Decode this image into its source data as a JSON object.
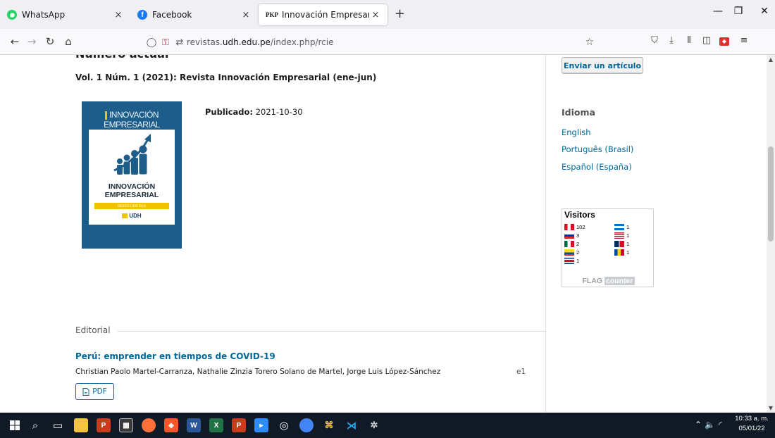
{
  "browser": {
    "tabs": [
      {
        "label": "WhatsApp",
        "favicon": "whatsapp-icon",
        "active": false
      },
      {
        "label": "Facebook",
        "favicon": "facebook-icon",
        "active": false
      },
      {
        "label": "Innovación Empresarial",
        "favicon": "pkp-icon",
        "favicon_text": "PKP",
        "active": true
      }
    ],
    "close_glyph": "×",
    "new_tab_glyph": "+",
    "url_prefix": "revistas.",
    "url_host": "udh.edu.pe",
    "url_path": "/index.php/rcie",
    "window_controls": {
      "minimize": "—",
      "maximize": "❐",
      "close": "✕"
    }
  },
  "page": {
    "clipped_heading": "Número actual",
    "issue_title": "Vol. 1 Núm. 1 (2021): Revista Innovación Empresarial (ene-jun)",
    "cover": {
      "top_text": "INNOVACIÓN EMPRESARIAL",
      "name_line1": "INNOVACIÓN",
      "name_line2": "EMPRESARIAL",
      "band_text": "REVISTA CIENTÍFICA",
      "logo_text": "UDH"
    },
    "published_label": "Publicado:",
    "published_date": "2021-10-30",
    "section_label": "Editorial",
    "article": {
      "title": "Perú: emprender en tiempos de COVID-19",
      "authors": "Christian Paolo Martel-Carranza, Nathalie Zinzia Torero Solano de Martel, Jorge Luis López-Sánchez",
      "pages": "e1",
      "pdf_label": "PDF"
    }
  },
  "sidebar": {
    "submit_label": "Enviar un artículo",
    "language_title": "Idioma",
    "languages": [
      "English",
      "Português (Brasil)",
      "Español (España)"
    ],
    "visitors": {
      "title": "Visitors",
      "entries": [
        {
          "country": "Peru",
          "count": "102"
        },
        {
          "country": "Russia",
          "count": "3"
        },
        {
          "country": "Mexico",
          "count": "2"
        },
        {
          "country": "Ecuador",
          "count": "2"
        },
        {
          "country": "Costa Rica",
          "count": "1"
        },
        {
          "country": "Honduras",
          "count": "1"
        },
        {
          "country": "United States",
          "count": "1"
        },
        {
          "country": "Dominican Republic",
          "count": "1"
        },
        {
          "country": "Moldova",
          "count": "1"
        }
      ],
      "brand_flag": "FLAG",
      "brand_counter": "counter"
    }
  },
  "taskbar": {
    "clock_time": "10:33 a. m.",
    "clock_date": "05/01/22"
  },
  "colors": {
    "link": "#006798",
    "cover_blue": "#1d5d8a",
    "cover_yellow": "#f2c300",
    "taskbar": "#101a26"
  }
}
